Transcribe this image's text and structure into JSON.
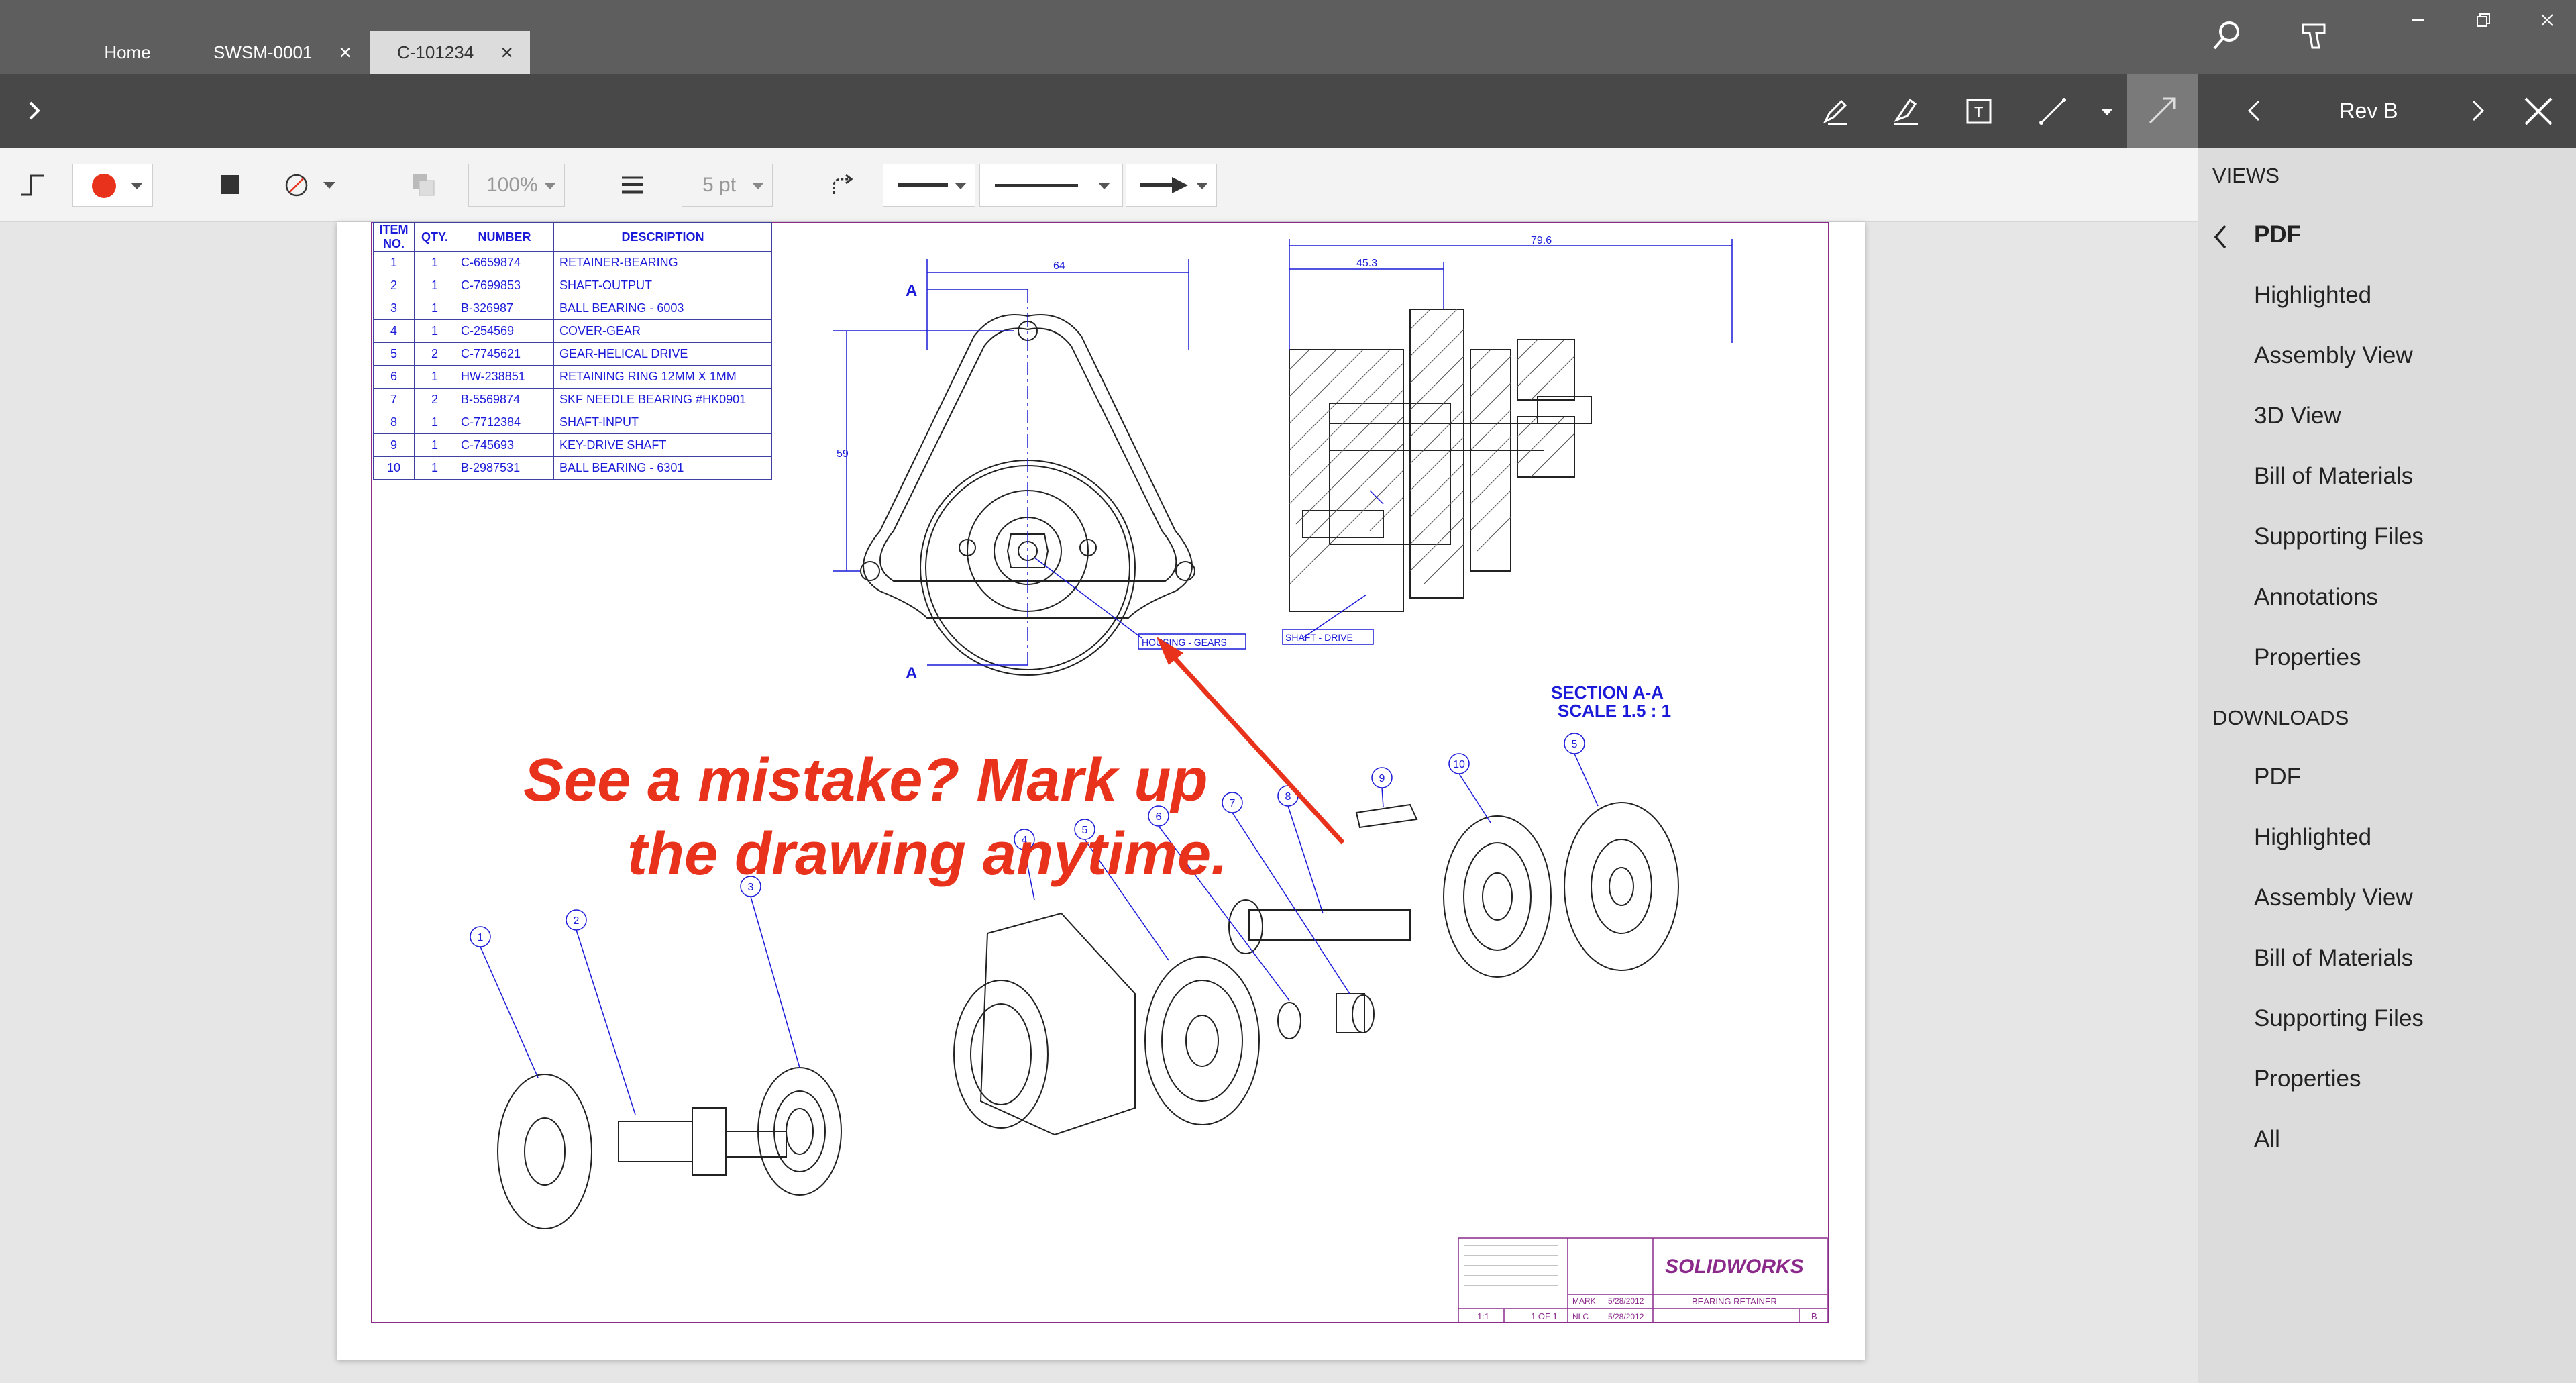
{
  "tabs": [
    {
      "label": "Home"
    },
    {
      "label": "SWSM-0001",
      "close": "×"
    },
    {
      "label": "C-101234",
      "close": "×"
    }
  ],
  "rev": {
    "label": "Rev B"
  },
  "toolbar": {
    "zoom": "100%",
    "stroke_width": "5 pt"
  },
  "colors": {
    "accent_red": "#e8321c",
    "drawing_blue": "#1a1ad8",
    "frame_purple": "#8b2a8b"
  },
  "sidebar": {
    "views_header": "VIEWS",
    "views": [
      {
        "label": "PDF",
        "selected": true
      },
      {
        "label": "Highlighted"
      },
      {
        "label": "Assembly View"
      },
      {
        "label": "3D View"
      },
      {
        "label": "Bill of Materials"
      },
      {
        "label": "Supporting Files"
      },
      {
        "label": "Annotations"
      },
      {
        "label": "Properties"
      }
    ],
    "downloads_header": "DOWNLOADS",
    "downloads": [
      {
        "label": "PDF"
      },
      {
        "label": "Highlighted"
      },
      {
        "label": "Assembly View"
      },
      {
        "label": "Bill of Materials"
      },
      {
        "label": "Supporting Files"
      },
      {
        "label": "Properties"
      },
      {
        "label": "All"
      }
    ]
  },
  "bom": {
    "headers": [
      "ITEM NO.",
      "QTY.",
      "NUMBER",
      "DESCRIPTION"
    ],
    "rows": [
      [
        "1",
        "1",
        "C-6659874",
        "RETAINER-BEARING"
      ],
      [
        "2",
        "1",
        "C-7699853",
        "SHAFT-OUTPUT"
      ],
      [
        "3",
        "1",
        "B-326987",
        "BALL BEARING - 6003"
      ],
      [
        "4",
        "1",
        "C-254569",
        "COVER-GEAR"
      ],
      [
        "5",
        "2",
        "C-7745621",
        "GEAR-HELICAL DRIVE"
      ],
      [
        "6",
        "1",
        "HW-238851",
        "RETAINING RING 12MM X 1MM"
      ],
      [
        "7",
        "2",
        "B-5569874",
        "SKF NEEDLE BEARING #HK0901"
      ],
      [
        "8",
        "1",
        "C-7712384",
        "SHAFT-INPUT"
      ],
      [
        "9",
        "1",
        "C-745693",
        "KEY-DRIVE SHAFT"
      ],
      [
        "10",
        "1",
        "B-2987531",
        "BALL BEARING - 6301"
      ]
    ]
  },
  "drawing": {
    "dim_64": "64",
    "dim_59": "59",
    "dim_79_6": "79.6",
    "dim_45_3": "45.3",
    "section_letter": "A",
    "label_shaft": "SHAFT - DRIVE",
    "label_housing": "HOUSING - GEARS",
    "section_title": "SECTION A-A",
    "section_scale": "SCALE 1.5 : 1",
    "balloons": [
      "1",
      "2",
      "3",
      "4",
      "5",
      "6",
      "7",
      "8",
      "9",
      "10",
      "5"
    ],
    "callout_line1": "See a mistake? Mark up",
    "callout_line2": "the drawing anytime.",
    "title_block": {
      "brand": "SOLIDWORKS",
      "title": "BEARING RETAINER",
      "date1": "5/28/2012",
      "date2": "5/28/2012",
      "name1": "MARK",
      "name2": "NLC",
      "scale": "1:1",
      "sheet": "1 OF 1",
      "rev": "B"
    }
  }
}
